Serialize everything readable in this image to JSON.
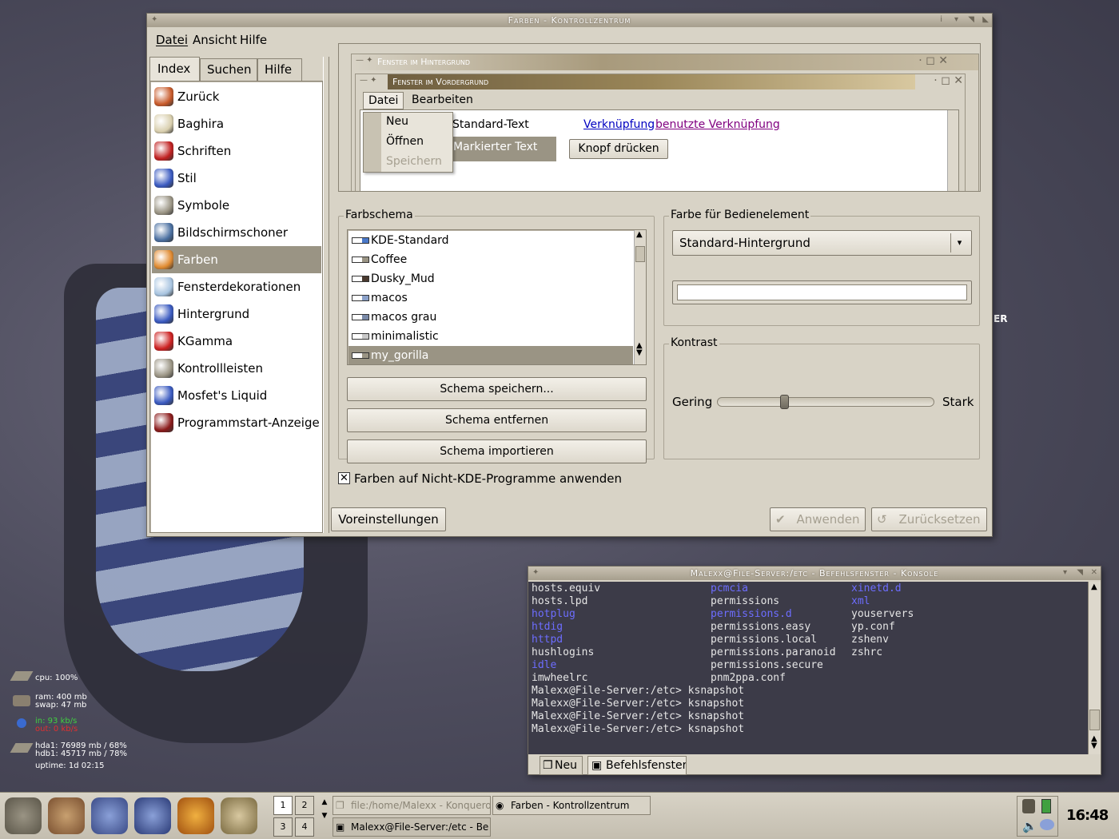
{
  "window": {
    "title": "Farben - Kontrollzentrum",
    "menu": [
      "Datei",
      "Ansicht",
      "Hilfe"
    ]
  },
  "tabs": [
    "Index",
    "Suchen",
    "Hilfe"
  ],
  "nav": [
    {
      "label": "Zurück",
      "icon": "back-arrow-icon",
      "color": "#c85a2a"
    },
    {
      "label": "Baghira",
      "icon": "baghira-icon",
      "color": "#d9cfae"
    },
    {
      "label": "Schriften",
      "icon": "fonts-icon",
      "color": "#c02020"
    },
    {
      "label": "Stil",
      "icon": "style-icon",
      "color": "#3a5ac0"
    },
    {
      "label": "Symbole",
      "icon": "symbols-icon",
      "color": "#9a9484"
    },
    {
      "label": "Bildschirmschoner",
      "icon": "screensaver-icon",
      "color": "#4a6fa0"
    },
    {
      "label": "Farben",
      "icon": "colors-icon",
      "color": "#e08a30",
      "selected": true
    },
    {
      "label": "Fensterdekorationen",
      "icon": "window-decoration-icon",
      "color": "#a8c4e0"
    },
    {
      "label": "Hintergrund",
      "icon": "background-icon",
      "color": "#3a5ac0"
    },
    {
      "label": "KGamma",
      "icon": "kgamma-icon",
      "color": "#cc2020"
    },
    {
      "label": "Kontrollleisten",
      "icon": "panels-icon",
      "color": "#9a9484"
    },
    {
      "label": "Mosfet's Liquid",
      "icon": "liquid-icon",
      "color": "#3a5ac0"
    },
    {
      "label": "Programmstart-Anzeige",
      "icon": "launch-feedback-icon",
      "color": "#8a1a1a"
    }
  ],
  "preview": {
    "bg_title": "Fenster im Hintergrund",
    "fg_title": "Fenster im Vordergrund",
    "menu": [
      "Datei",
      "Bearbeiten"
    ],
    "dropdown": [
      "Neu",
      "Öffnen",
      "Speichern"
    ],
    "standard_text": "Standard-Text",
    "link": "Verknüpfung",
    "visited_link": "benutzte Verknüpfung",
    "selected_text": "Markierter Text",
    "button": "Knopf drücken"
  },
  "scheme": {
    "title": "Farbschema",
    "items": [
      {
        "name": "KDE-Standard",
        "color": "#4a78c8"
      },
      {
        "name": "Coffee",
        "color": "#9a9484"
      },
      {
        "name": "Dusky_Mud",
        "color": "#4a3a30"
      },
      {
        "name": "macos",
        "color": "#8aa0c8"
      },
      {
        "name": "macos grau",
        "color": "#7a8aa8"
      },
      {
        "name": "minimalistic",
        "color": "#c8c8c8"
      },
      {
        "name": "my_gorilla",
        "color": "#9a9484",
        "selected": true
      }
    ],
    "buttons": [
      "Schema speichern...",
      "Schema entfernen",
      "Schema importieren"
    ]
  },
  "widget": {
    "title": "Farbe für Bedienelement",
    "selected": "Standard-Hintergrund"
  },
  "contrast": {
    "title": "Kontrast",
    "low": "Gering",
    "high": "Stark",
    "value": 0.3
  },
  "apply_nonkde": {
    "label": "Farben auf Nicht-KDE-Programme anwenden",
    "checked": true
  },
  "bottom": {
    "defaults": "Voreinstellungen",
    "apply": "Anwenden",
    "reset": "Zurücksetzen"
  },
  "konsole": {
    "title": "Malexx@File-Server:/etc - Befehlsfenster - Konsole",
    "col1": [
      {
        "t": "hosts.equiv"
      },
      {
        "t": "hosts.lpd"
      },
      {
        "t": "hotplug",
        "d": true
      },
      {
        "t": "htdig",
        "d": true
      },
      {
        "t": "httpd",
        "d": true
      },
      {
        "t": "hushlogins"
      },
      {
        "t": "idle",
        "d": true
      },
      {
        "t": "imwheelrc"
      }
    ],
    "col2": [
      {
        "t": "pcmcia",
        "d": true
      },
      {
        "t": "permissions"
      },
      {
        "t": "permissions.d",
        "d": true
      },
      {
        "t": "permissions.easy"
      },
      {
        "t": "permissions.local"
      },
      {
        "t": "permissions.paranoid"
      },
      {
        "t": "permissions.secure"
      },
      {
        "t": "pnm2ppa.conf"
      }
    ],
    "col3": [
      {
        "t": "xinetd.d",
        "d": true
      },
      {
        "t": "xml",
        "d": true
      },
      {
        "t": "youservers"
      },
      {
        "t": "yp.conf"
      },
      {
        "t": "zshenv"
      },
      {
        "t": "zshrc"
      }
    ],
    "prompts": [
      "Malexx@File-Server:/etc> ksnapshot",
      "Malexx@File-Server:/etc> ksnapshot",
      "Malexx@File-Server:/etc> ksnapshot",
      "Malexx@File-Server:/etc> ksnapshot"
    ],
    "tabs": [
      "Neu",
      "Befehlsfenster"
    ]
  },
  "monitor": {
    "cpu": "cpu: 100%",
    "ram": "ram: 400 mb",
    "swap": "swap: 47 mb",
    "net_in": "in: 93 kb/s",
    "net_out": "out: 0 kb/s",
    "hda1": "hda1: 76989 mb / 68%",
    "hdb1": "hdb1: 45717 mb / 78%",
    "uptime": "uptime: 1d 02:15"
  },
  "taskbar": {
    "pager": [
      "1",
      "2",
      "3",
      "4"
    ],
    "tasks": [
      "file:/home/Malexx - Konqueror",
      "Farben - Kontrollzentrum",
      "Malexx@File-Server:/etc - Be"
    ],
    "clock": "16:48"
  }
}
